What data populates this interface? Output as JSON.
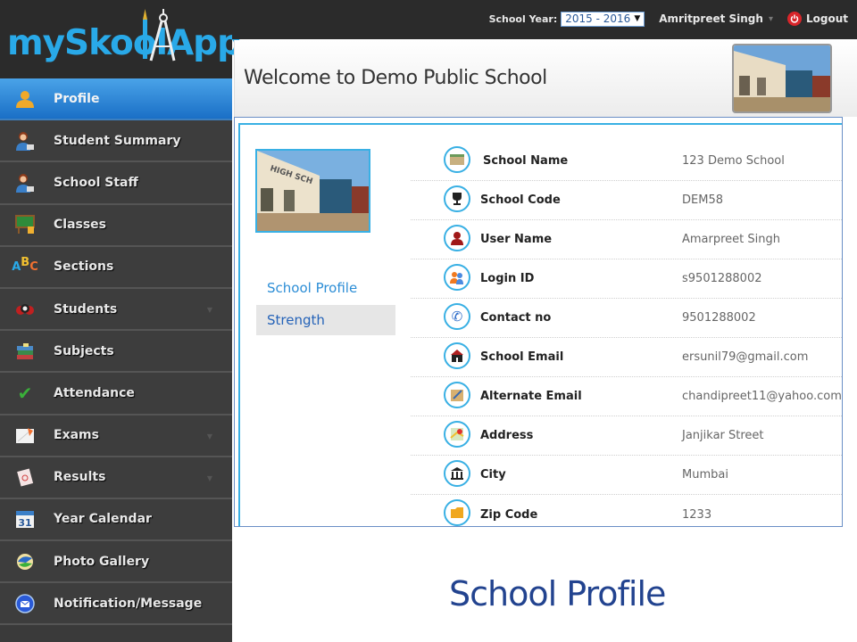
{
  "app": {
    "logo_text": "mySkoolApp"
  },
  "topbar": {
    "school_year_label": "School Year:",
    "school_year_value": "2015 - 2016",
    "user_name": "Amritpreet Singh",
    "logout_label": "Logout"
  },
  "sidebar": {
    "items": [
      {
        "label": "Profile",
        "icon": "person-icon",
        "active": true,
        "has_caret": false
      },
      {
        "label": "Student Summary",
        "icon": "teacher-icon",
        "has_caret": false
      },
      {
        "label": "School Staff",
        "icon": "teacher-icon",
        "has_caret": false
      },
      {
        "label": "Classes",
        "icon": "blackboard-icon",
        "has_caret": false
      },
      {
        "label": "Sections",
        "icon": "abc-blocks-icon",
        "has_caret": false
      },
      {
        "label": "Students",
        "icon": "students-group-icon",
        "has_caret": true
      },
      {
        "label": "Subjects",
        "icon": "books-icon",
        "has_caret": false
      },
      {
        "label": "Attendance",
        "icon": "checkmark-icon",
        "has_caret": false
      },
      {
        "label": "Exams",
        "icon": "exam-paper-icon",
        "has_caret": true
      },
      {
        "label": "Results",
        "icon": "result-sheet-icon",
        "has_caret": true
      },
      {
        "label": "Year Calendar",
        "icon": "calendar-icon",
        "has_caret": false
      },
      {
        "label": "Photo Gallery",
        "icon": "photo-gallery-icon",
        "has_caret": false
      },
      {
        "label": "Notification/Message",
        "icon": "message-icon",
        "has_caret": false
      }
    ]
  },
  "header": {
    "welcome": "Welcome to Demo Public School"
  },
  "profile_nav": {
    "school_profile": "School Profile",
    "strength": "Strength"
  },
  "profile_fields": [
    {
      "label": "School Name",
      "value": "123 Demo School",
      "icon": "school-building-icon"
    },
    {
      "label": "School Code",
      "value": "DEM58",
      "icon": "trophy-icon"
    },
    {
      "label": "User Name",
      "value": "Amarpreet Singh",
      "icon": "user-icon"
    },
    {
      "label": "Login ID",
      "value": "s9501288002",
      "icon": "users-icon"
    },
    {
      "label": "Contact no",
      "value": "9501288002",
      "icon": "phone-icon"
    },
    {
      "label": "School Email",
      "value": "ersunil79@gmail.com",
      "icon": "schoolhouse-icon"
    },
    {
      "label": "Alternate Email",
      "value": "chandipreet11@yahoo.com",
      "icon": "notepad-icon"
    },
    {
      "label": "Address",
      "value": "Janjikar Street",
      "icon": "map-icon"
    },
    {
      "label": "City",
      "value": "Mumbai",
      "icon": "city-hall-icon"
    },
    {
      "label": "Zip Code",
      "value": "1233",
      "icon": "folder-icon"
    }
  ],
  "caption": "School Profile",
  "colors": {
    "brand": "#29a9e8",
    "active_nav": "#1a6fc6",
    "accent_border": "#39b0e4",
    "caption": "#22438f",
    "logout": "#d9252a"
  }
}
